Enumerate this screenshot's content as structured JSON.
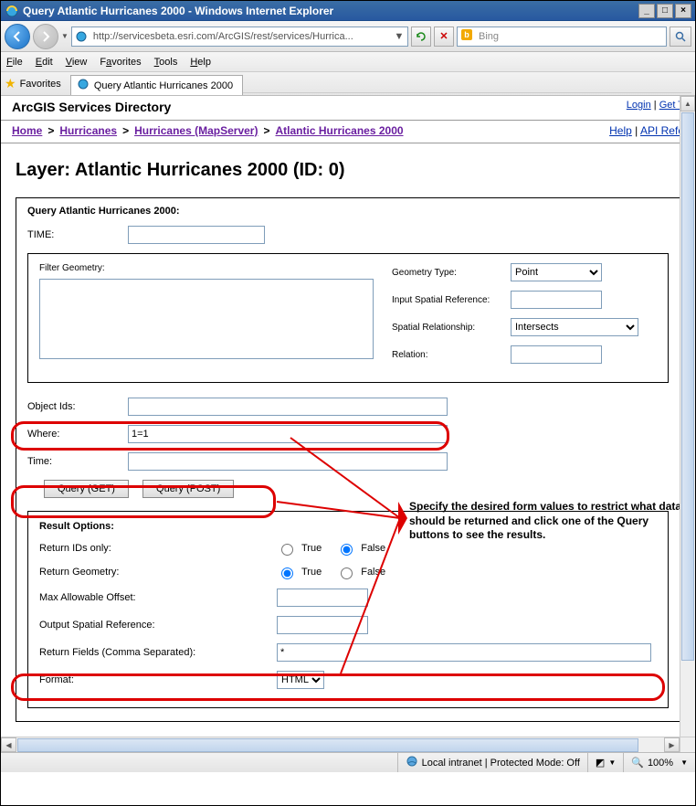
{
  "window": {
    "title": "Query Atlantic Hurricanes 2000 - Windows Internet Explorer"
  },
  "address": {
    "url": "http://servicesbeta.esri.com/ArcGIS/rest/services/Hurrica..."
  },
  "search": {
    "placeholder": "Bing"
  },
  "menus": [
    "File",
    "Edit",
    "View",
    "Favorites",
    "Tools",
    "Help"
  ],
  "favorites_label": "Favorites",
  "tab": {
    "title": "Query Atlantic Hurricanes 2000"
  },
  "svc_header": {
    "title": "ArcGIS Services Directory",
    "login": "Login",
    "get_token": "Get T"
  },
  "breadcrumbs": {
    "items": [
      "Home",
      "Hurricanes",
      "Hurricanes (MapServer)",
      "Atlantic Hurricanes 2000"
    ],
    "help": "Help",
    "api_ref": "API Refe"
  },
  "page_title": "Layer: Atlantic Hurricanes 2000 (ID: 0)",
  "form": {
    "legend": "Query Atlantic Hurricanes 2000:",
    "time_label": "TIME:",
    "time_value": "",
    "filter_geom_label": "Filter Geometry:",
    "filter_geom_value": "",
    "geom_type_label": "Geometry Type:",
    "geom_type_value": "Point",
    "in_sr_label": "Input Spatial Reference:",
    "in_sr_value": "",
    "spatial_rel_label": "Spatial Relationship:",
    "spatial_rel_value": "Intersects",
    "relation_label": "Relation:",
    "relation_value": "",
    "object_ids_label": "Object Ids:",
    "object_ids_value": "",
    "where_label": "Where:",
    "where_value": "1=1",
    "time2_label": "Time:",
    "time2_value": "",
    "btn_get": "Query (GET)",
    "btn_post": "Query (POST)",
    "result_legend": "Result Options:",
    "return_ids_label": "Return IDs only:",
    "return_geom_label": "Return Geometry:",
    "true_lbl": "True",
    "false_lbl": "False",
    "max_offset_label": "Max Allowable Offset:",
    "max_offset_value": "",
    "out_sr_label": "Output Spatial Reference:",
    "out_sr_value": "",
    "return_fields_label": "Return Fields (Comma Separated):",
    "return_fields_value": "*",
    "format_label": "Format:",
    "format_value": "HTML"
  },
  "annotation": "Specify the desired form values to restrict what data should be returned and click one of the Query buttons to see the results.",
  "status": {
    "zone": "Local intranet | Protected Mode: Off",
    "zoom": "100%"
  }
}
